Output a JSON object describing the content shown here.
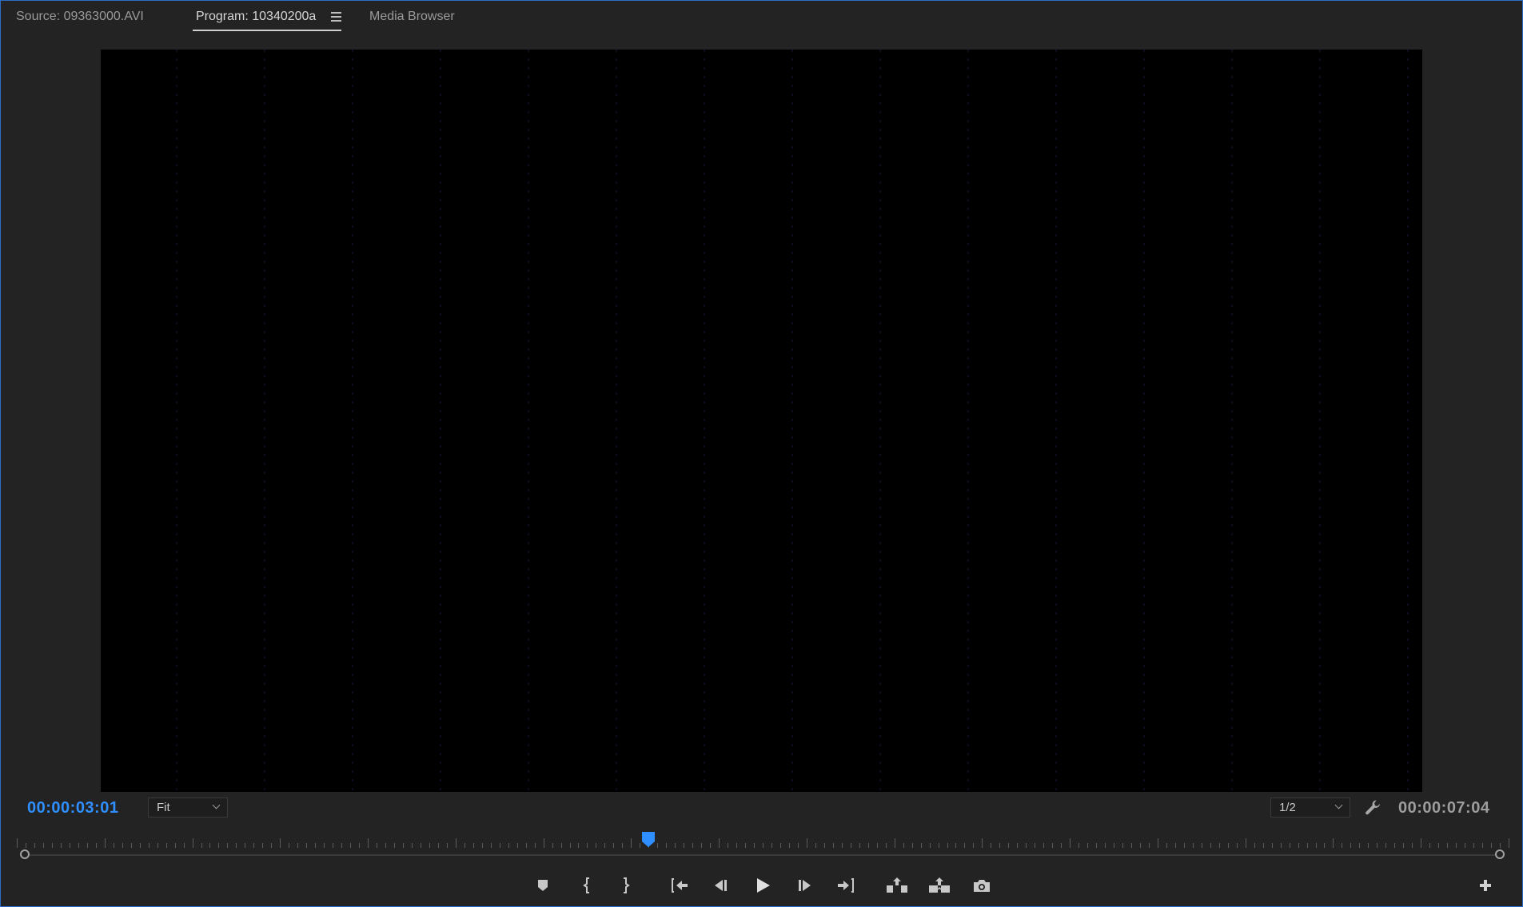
{
  "tabs": {
    "source": "Source: 09363000.AVI",
    "program": "Program: 10340200a",
    "media_browser": "Media Browser"
  },
  "monitor": {
    "current_timecode": "00:00:03:01",
    "duration_timecode": "00:00:07:04",
    "zoom": {
      "selected": "Fit"
    },
    "resolution": {
      "selected": "1/2"
    },
    "playhead_position_fraction": 0.43
  },
  "colors": {
    "accent": "#2f8fff",
    "panel_border": "#2d6cc4",
    "background": "#232323"
  },
  "transport": {
    "buttons": [
      "add-marker-icon",
      "mark-in-icon",
      "mark-out-icon",
      "go-to-in-icon",
      "step-back-icon",
      "play-icon",
      "step-forward-icon",
      "go-to-out-icon",
      "lift-icon",
      "extract-icon",
      "export-frame-icon"
    ],
    "add_button": "plus-icon"
  }
}
